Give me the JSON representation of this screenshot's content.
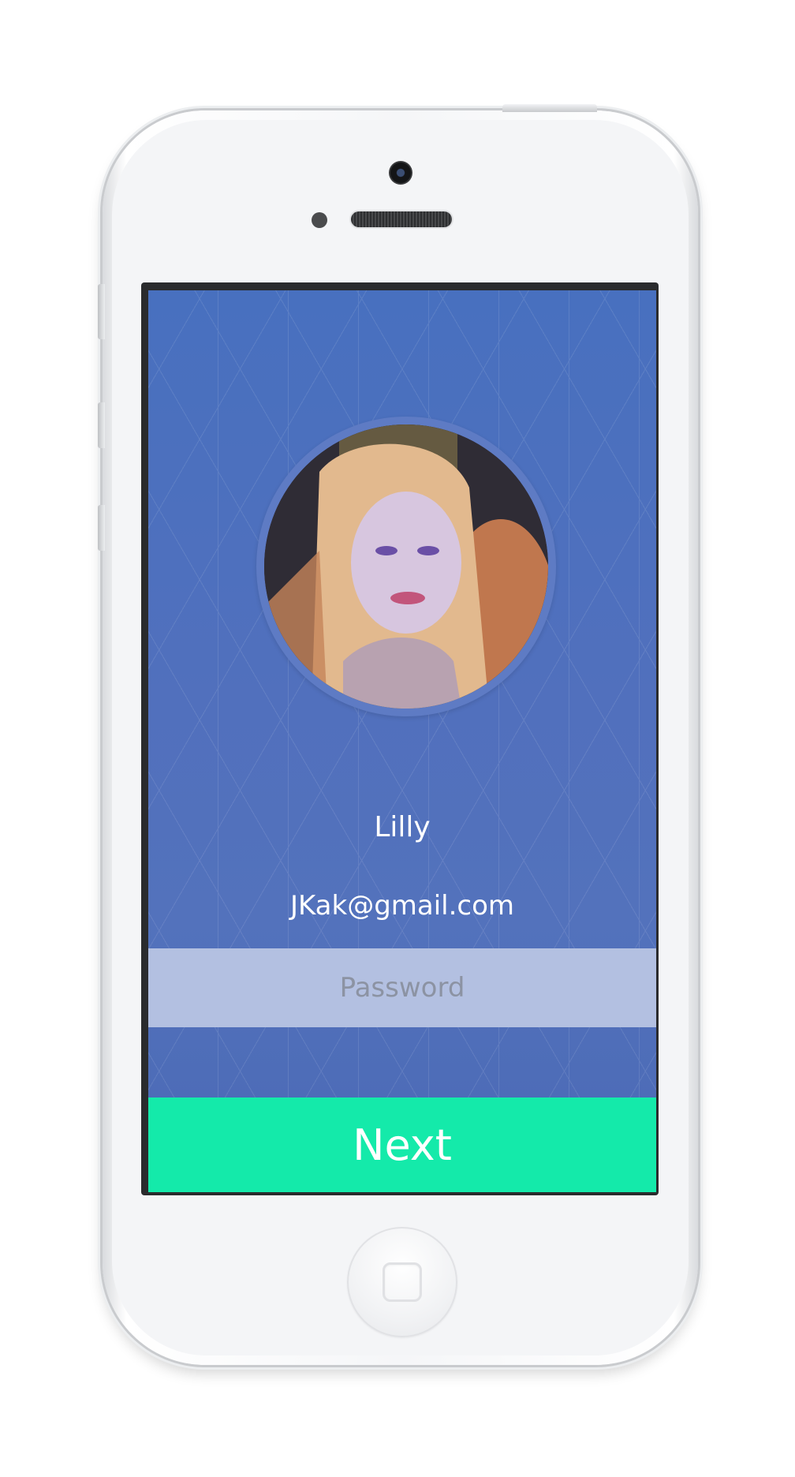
{
  "profile": {
    "name": "Lilly",
    "email": "JKak@gmail.com"
  },
  "form": {
    "password_placeholder": "Password",
    "password_value": ""
  },
  "actions": {
    "next_label": "Next"
  },
  "colors": {
    "screen_background": "#4a6cb8",
    "password_field": "#b3c0e1",
    "next_button": "#14eaaa",
    "text": "#ffffff"
  },
  "icons": {
    "avatar": "profile-photo"
  }
}
